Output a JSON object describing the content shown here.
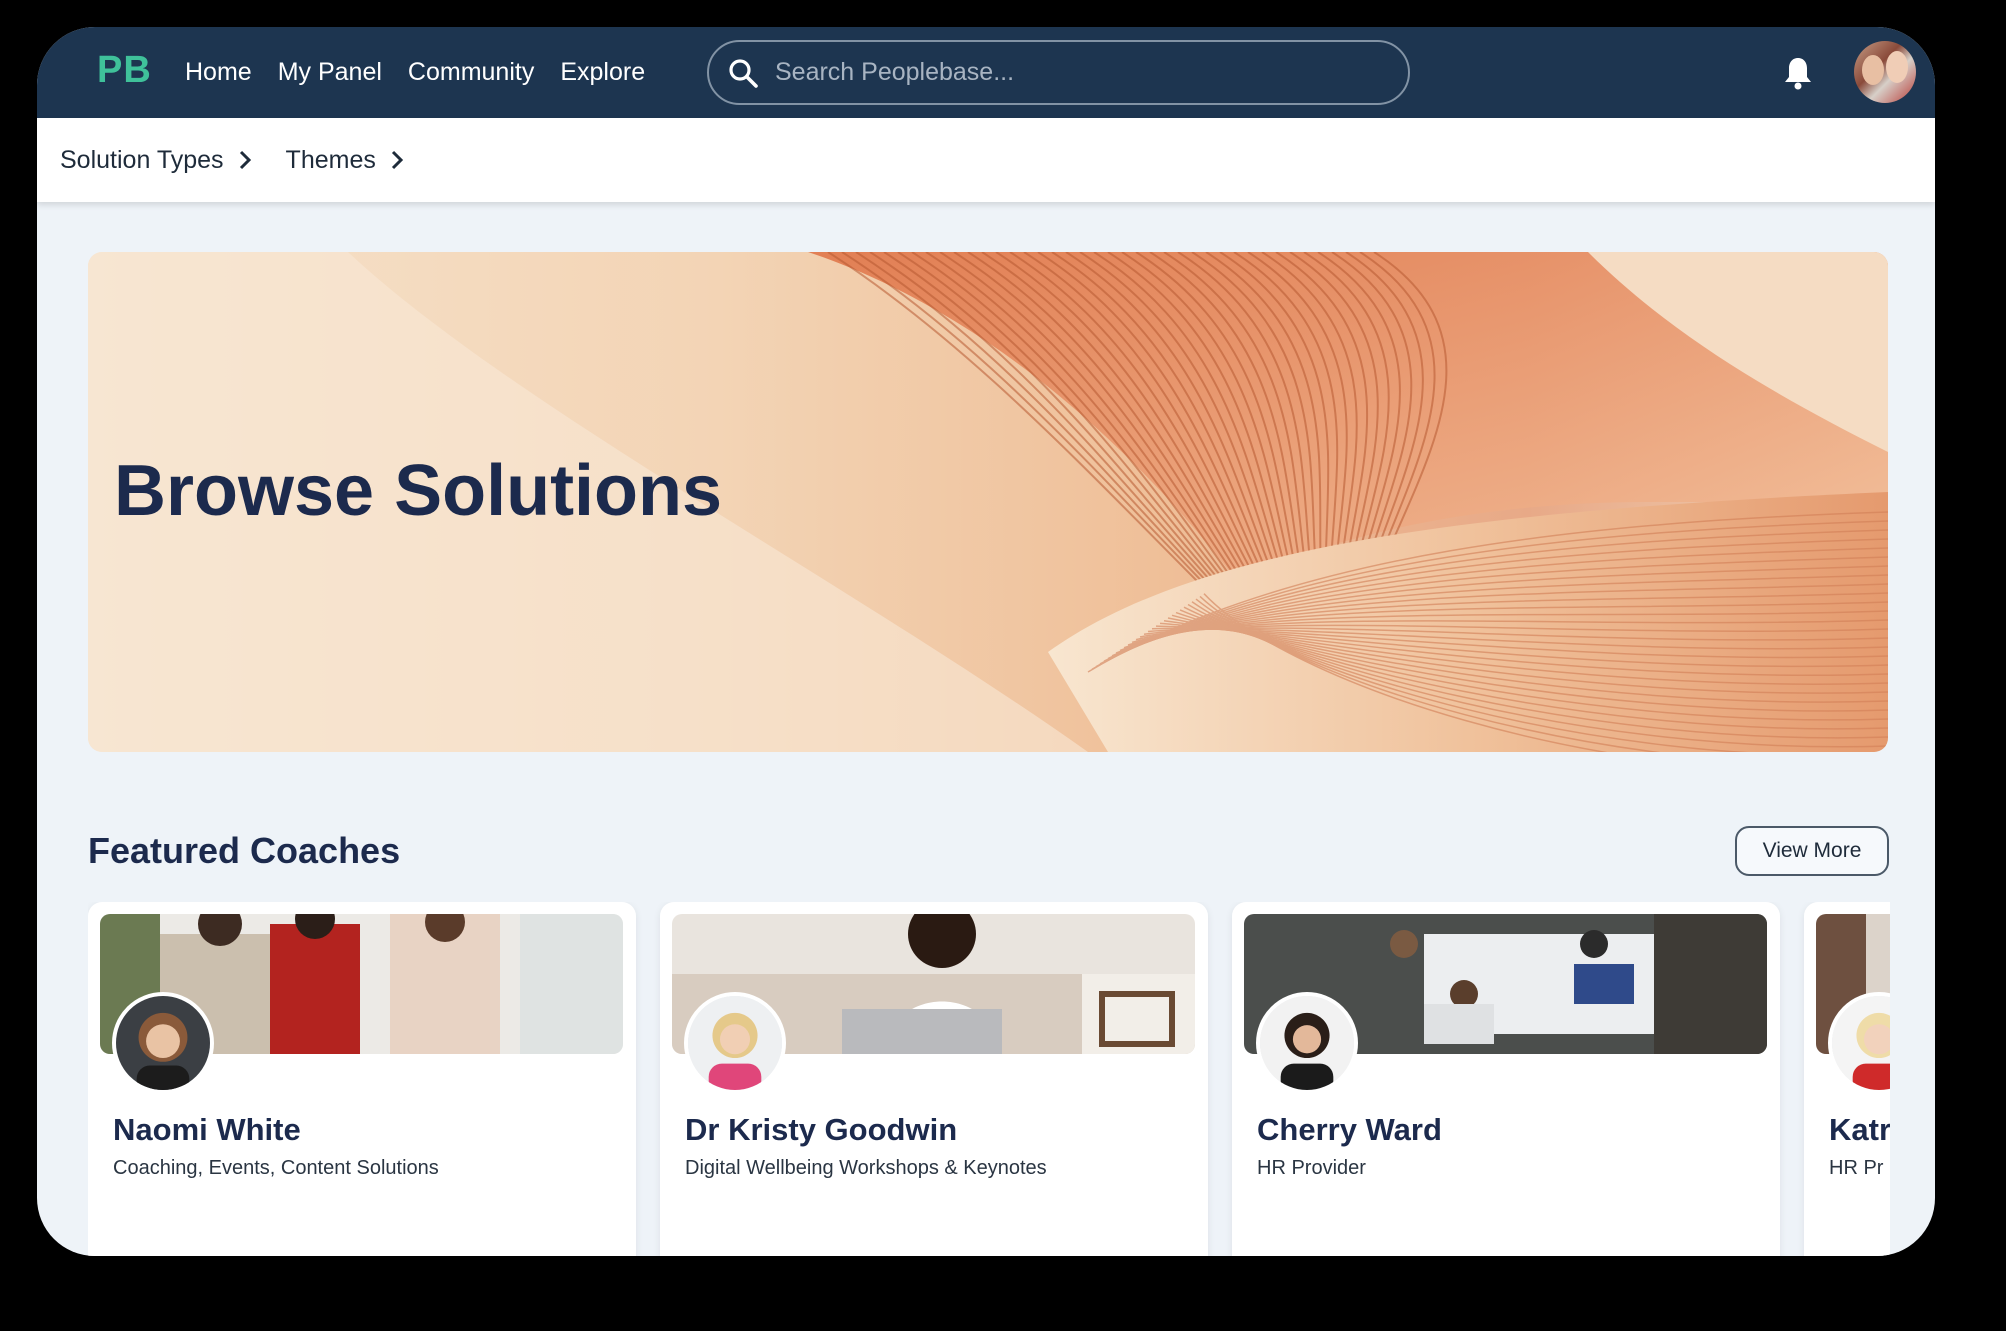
{
  "nav": {
    "logo": "PB",
    "links": [
      "Home",
      "My Panel",
      "Community",
      "Explore"
    ],
    "search_placeholder": "Search Peoplebase..."
  },
  "breadcrumbs": [
    "Solution Types",
    "Themes"
  ],
  "hero": {
    "title": "Browse Solutions"
  },
  "featured": {
    "title": "Featured Coaches",
    "view_more": "View More",
    "coaches": [
      {
        "name": "Naomi White",
        "desc": "Coaching, Events, Content Solutions"
      },
      {
        "name": "Dr Kristy Goodwin",
        "desc": "Digital Wellbeing Workshops & Keynotes"
      },
      {
        "name": "Cherry Ward",
        "desc": "HR Provider"
      },
      {
        "name": "Katr",
        "desc": "HR Pr"
      }
    ]
  },
  "colors": {
    "nav_bg": "#1d3550",
    "logo": "#3fc19a",
    "heading": "#1c2a4d",
    "page_bg": "#eef3f8"
  }
}
